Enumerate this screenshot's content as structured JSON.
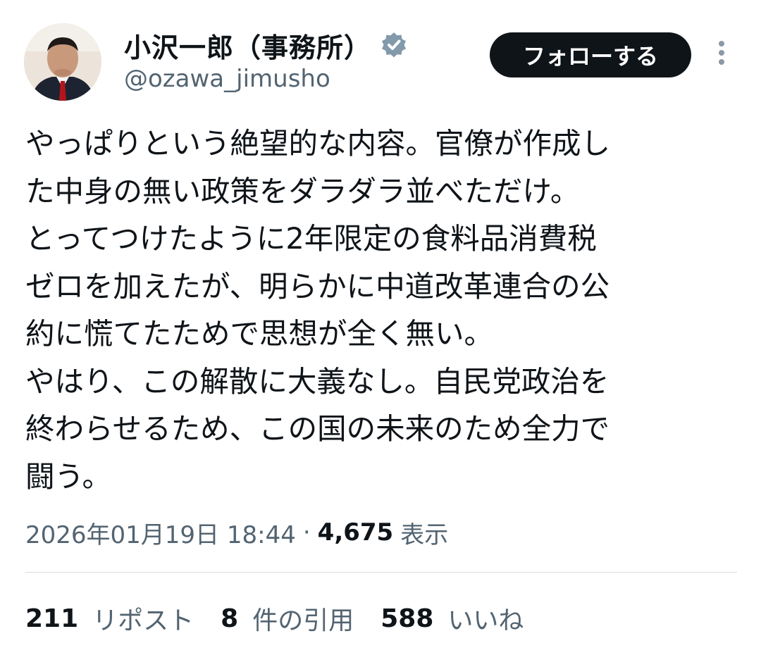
{
  "author": {
    "display_name": "小沢一郎（事務所）",
    "handle": "@ozawa_jimusho",
    "verified_color": "#829aab"
  },
  "follow_button": {
    "label": "フォローする"
  },
  "more_menu": {
    "icon": "more-vertical-icon"
  },
  "tweet": {
    "lines": [
      "やっぱりという絶望的な内容。官僚が作成し",
      "た中身の無い政策をダラダラ並べただけ。",
      "とってつけたように2年限定の食料品消費税",
      "ゼロを加えたが、明らかに中道改革連合の公",
      "約に慌てたためで思想が全く無い。",
      "やはり、この解散に大義なし。自民党政治を",
      "終わらせるため、この国の未来のため全力で",
      "闘う。"
    ]
  },
  "meta": {
    "timestamp": "2026年01月19日 18:44",
    "separator": "·",
    "views": "4,675",
    "views_label": "表示"
  },
  "stats": {
    "reposts": {
      "count": "211",
      "label": "リポスト"
    },
    "quotes": {
      "count": "8",
      "label": "件の引用"
    },
    "likes": {
      "count": "588",
      "label": "いいね"
    }
  }
}
